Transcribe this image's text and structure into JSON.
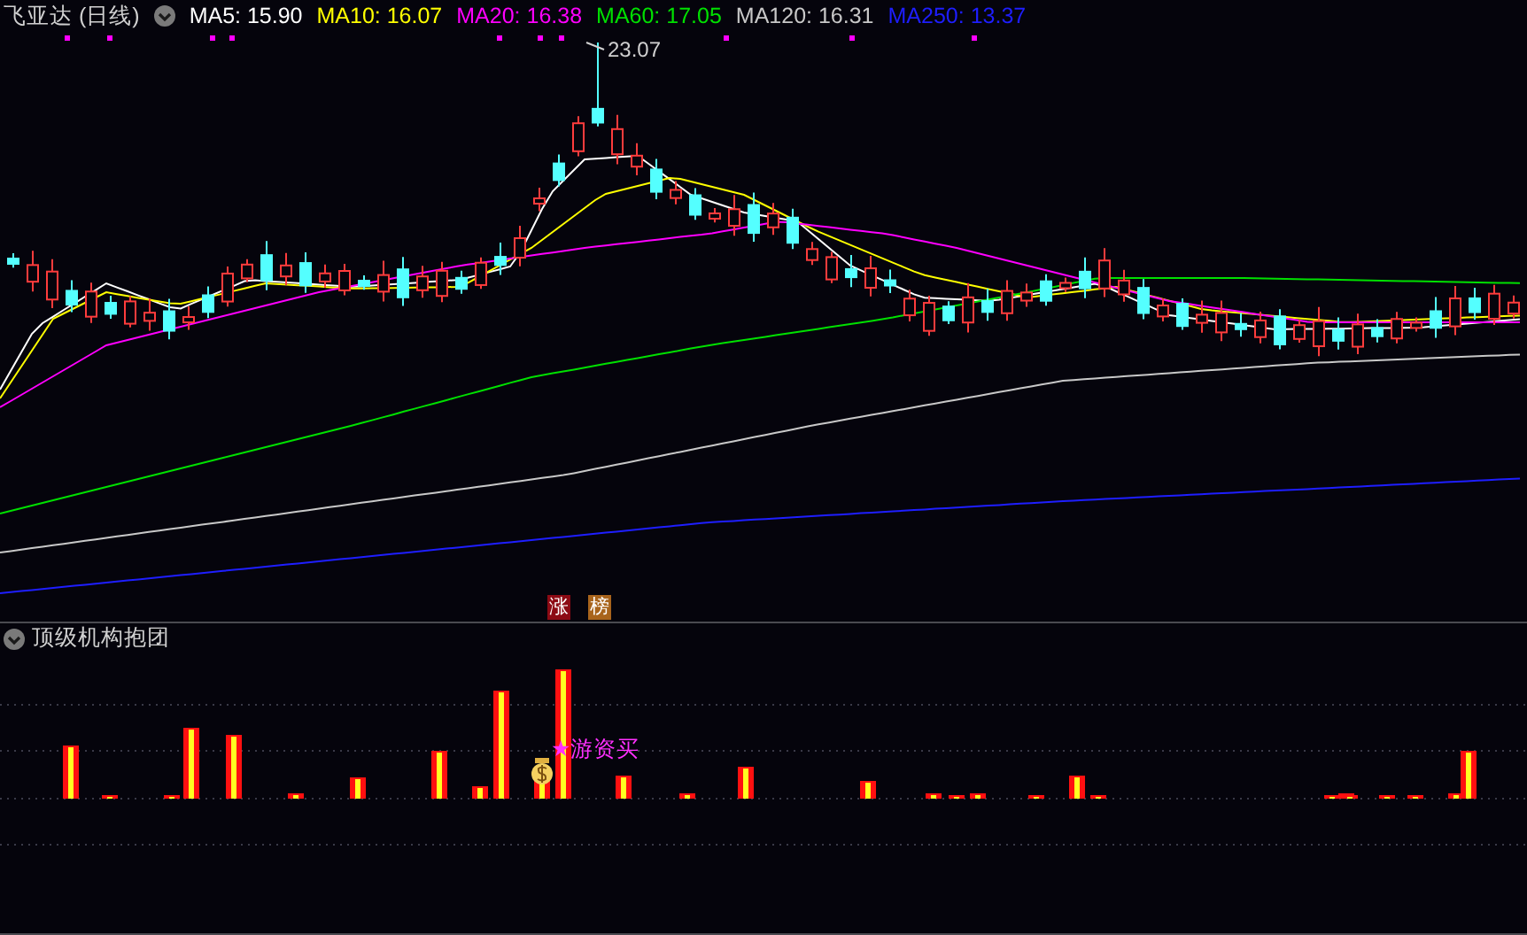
{
  "chart": {
    "title": "飞亚达 (日线)",
    "ma_lines": [
      {
        "text": "MA5: 15.90",
        "color": "#ffffff"
      },
      {
        "text": "MA10: 16.07",
        "color": "#ffff00"
      },
      {
        "text": "MA20: 16.38",
        "color": "#ff00ff"
      },
      {
        "text": "MA60: 17.05",
        "color": "#00e000"
      },
      {
        "text": "MA120: 16.31",
        "color": "#c8c8c8"
      },
      {
        "text": "MA250: 13.37",
        "color": "#1e1eff"
      }
    ],
    "peak_label": "23.07",
    "markers": [
      {
        "text": "涨",
        "color": "#8c0a14"
      },
      {
        "text": "榜",
        "color": "#a8641c"
      }
    ]
  },
  "indicator": {
    "title": "顶级机构抱团",
    "annotation": "★游资买"
  }
}
